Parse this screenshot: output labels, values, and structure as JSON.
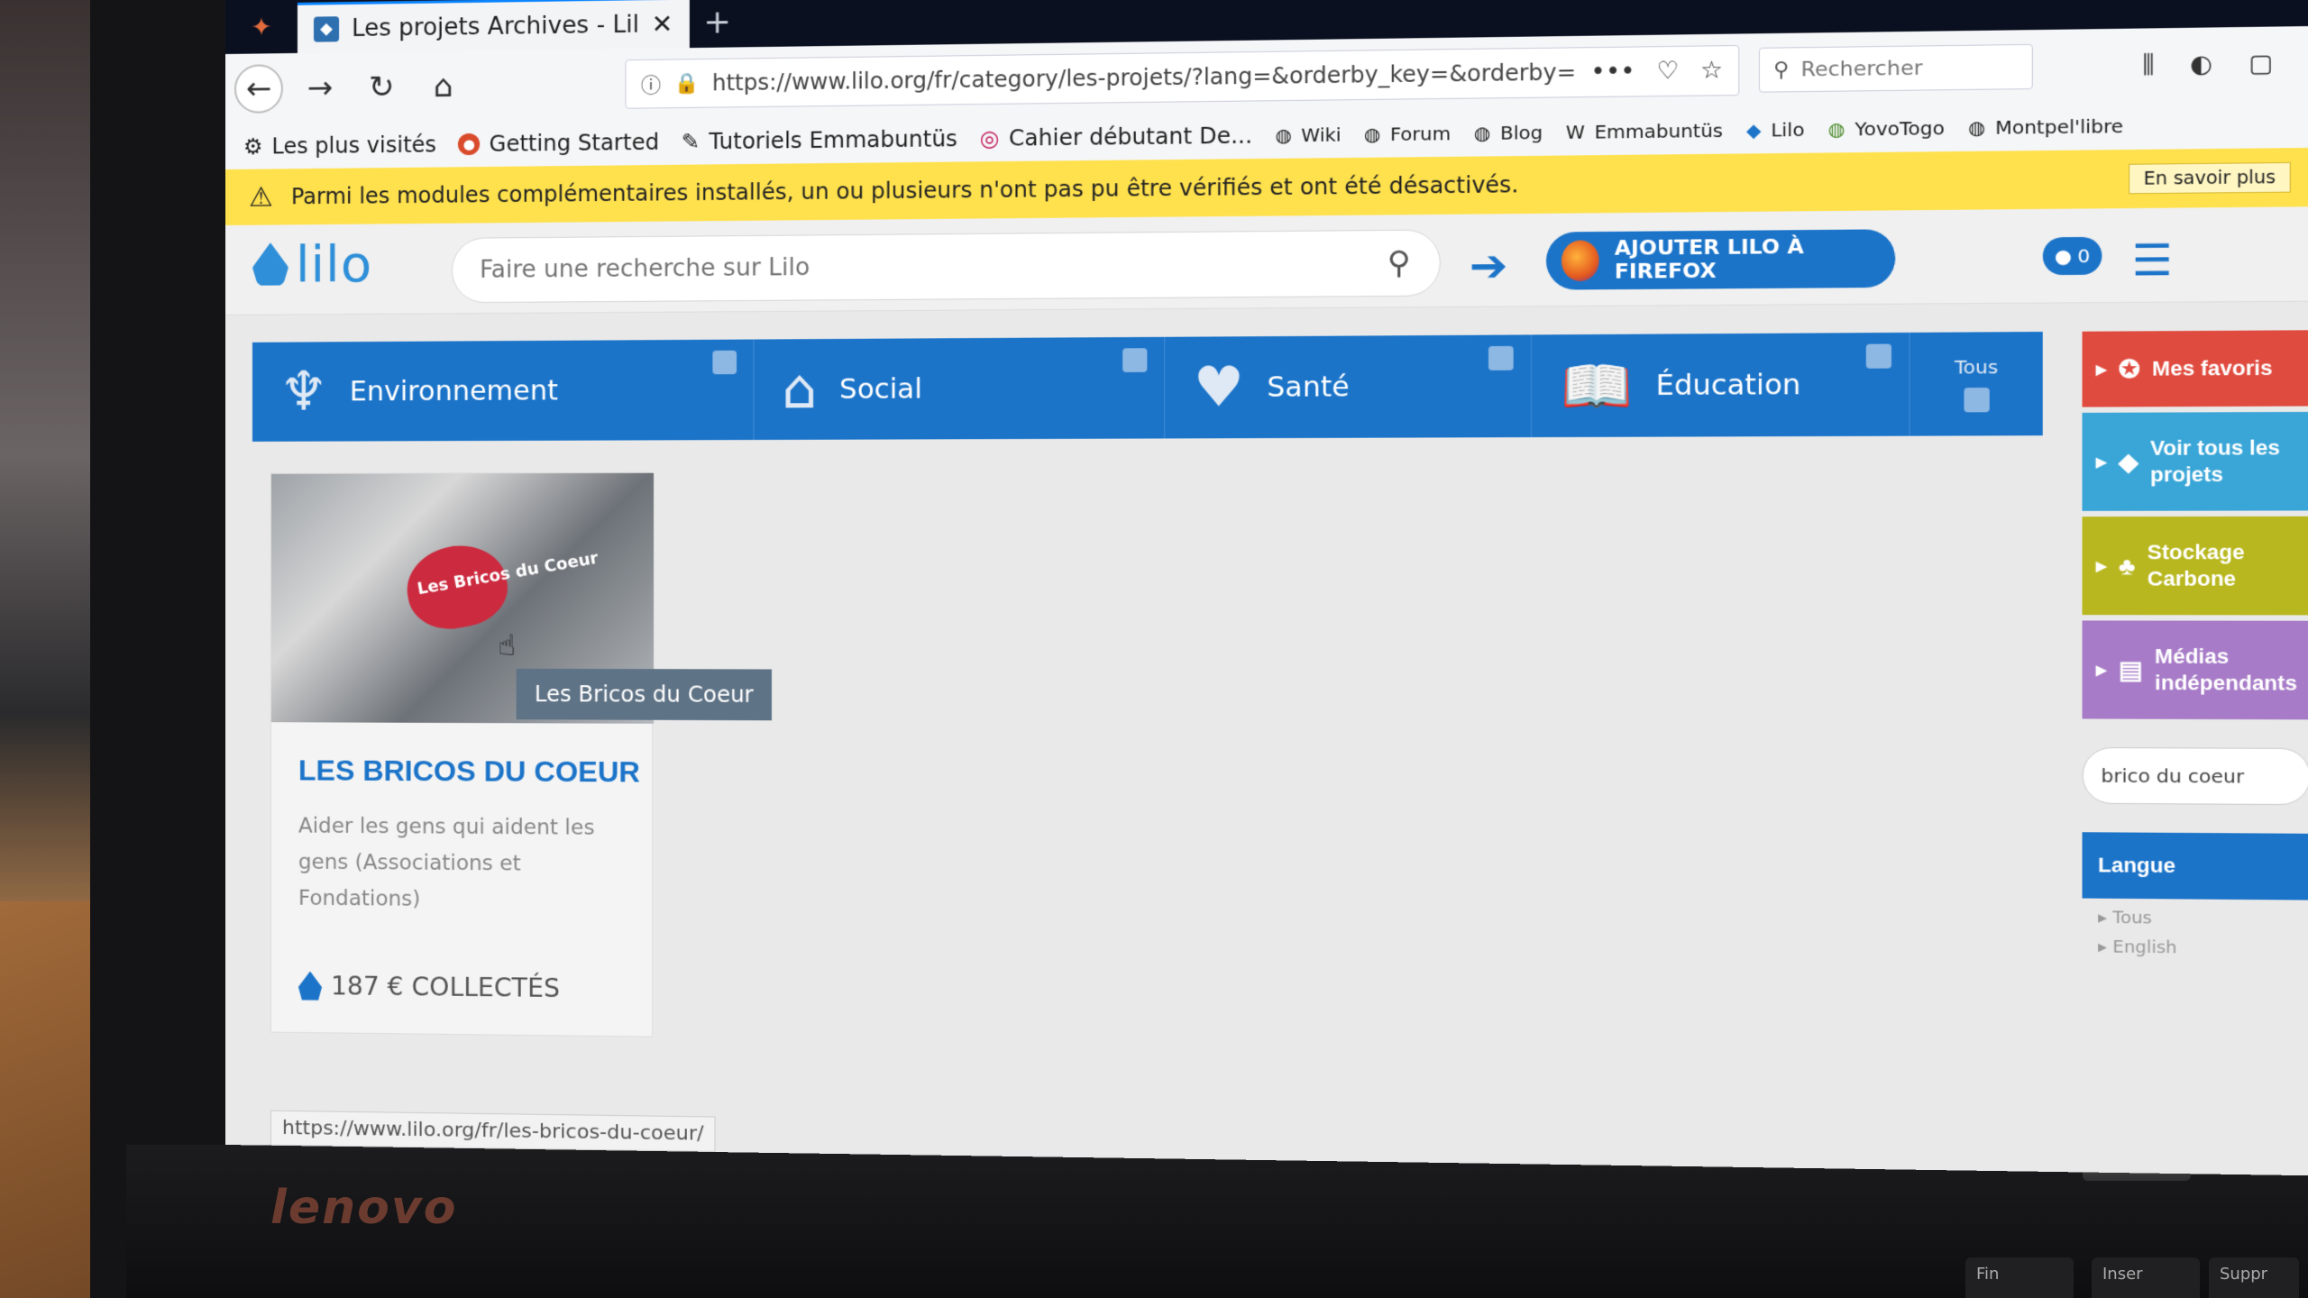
{
  "browser": {
    "tab_title": "Les projets Archives - Lilo",
    "new_tab": "+",
    "url": "https://www.lilo.org/fr/category/les-projets/?lang=&orderby_key=&orderby=&ord",
    "search_placeholder": "Rechercher",
    "bookmarks": [
      {
        "label": "Les plus visités",
        "icon": "gear-icon"
      },
      {
        "label": "Getting Started",
        "icon": "firefox-icon"
      },
      {
        "label": "Tutoriels Emmabuntüs",
        "icon": "tutorial-icon"
      },
      {
        "label": "Cahier débutant De...",
        "icon": "debian-icon"
      },
      {
        "label": "Wiki",
        "icon": "globe-icon"
      },
      {
        "label": "Forum",
        "icon": "globe-icon"
      },
      {
        "label": "Blog",
        "icon": "globe-icon"
      },
      {
        "label": "Emmabuntüs",
        "icon": "wikipedia-icon"
      },
      {
        "label": "Lilo",
        "icon": "lilo-icon"
      },
      {
        "label": "YovoTogo",
        "icon": "globe-icon"
      },
      {
        "label": "Montpel'libre",
        "icon": "globe-icon"
      }
    ]
  },
  "warning": {
    "text": "Parmi les modules complémentaires installés, un ou plusieurs n'ont pas pu être vérifiés et ont été désactivés.",
    "learn_more": "En savoir plus",
    "close": "×"
  },
  "lilo": {
    "logo": "lilo",
    "search_placeholder": "Faire une recherche sur Lilo",
    "add_button": "AJOUTER LILO À FIREFOX",
    "drops": "0"
  },
  "categories": [
    {
      "label": "Environnement",
      "icon": "tree-icon"
    },
    {
      "label": "Social",
      "icon": "house-icon"
    },
    {
      "label": "Santé",
      "icon": "heartbeat-icon"
    },
    {
      "label": "Éducation",
      "icon": "book-icon"
    }
  ],
  "all_label": "Tous",
  "card": {
    "image_text": "Les Bricos du Coeur",
    "tooltip": "Les Bricos du Coeur",
    "title": "LES BRICOS DU COEUR",
    "description": "Aider les gens qui aident les gens (Associations et Fondations)",
    "collected": "187 € COLLECTÉS"
  },
  "sidebar": {
    "items": [
      {
        "label": "Mes favoris",
        "color": "#e04b3f"
      },
      {
        "label": "Voir tous les projets",
        "color": "#3aa6d8"
      },
      {
        "label": "Stockage Carbone",
        "color": "#b8b71f"
      },
      {
        "label": "Médias indépendants",
        "color": "#a77bc7"
      }
    ],
    "search_value": "brico du coeur",
    "language_title": "Langue",
    "language_options": [
      "Tous",
      "English"
    ]
  },
  "status_url": "https://www.lilo.org/fr/les-bricos-du-coeur/",
  "device": {
    "brand": "lenovo",
    "keys": [
      "Fin",
      "Inser",
      "Suppr"
    ]
  },
  "colors": {
    "lilo_blue": "#1c74c9",
    "warning_yellow": "#ffe14d"
  }
}
